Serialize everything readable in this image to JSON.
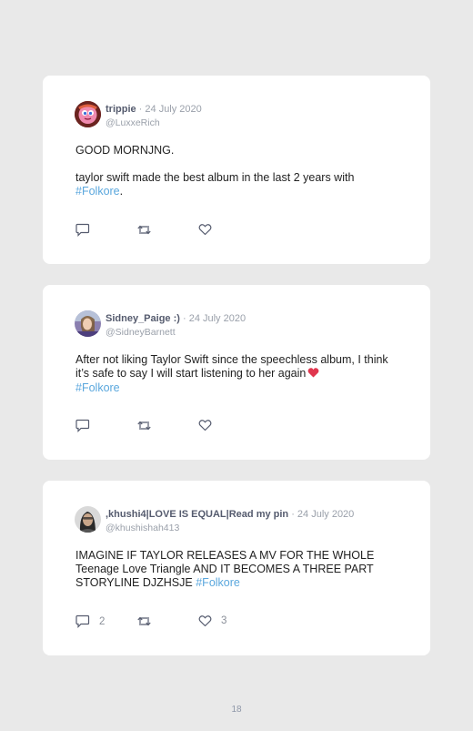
{
  "tweets": [
    {
      "name": "trippie",
      "date": " · 24 July 2020",
      "handle": "@LuxxeRich",
      "line1": "GOOD MORNJNG.",
      "line2": "taylor swift made the best album in the last 2 years with",
      "hashtag": "#Folkore",
      "after_hashtag": ".",
      "reply_count": "",
      "like_count": ""
    },
    {
      "name": "Sidney_Paige :)",
      "date": " · 24 July 2020",
      "handle": "@SidneyBarnett",
      "text": "After not liking Taylor Swift since the speechless album, I think it’s safe to say I will start listening to her again",
      "emoji": "red-heart-emoji",
      "hashtag": "#Folkore",
      "reply_count": "",
      "like_count": ""
    },
    {
      "name": ",khushi4|LOVE IS EQUAL|Read my pin",
      "date": " · 24 July 2020",
      "handle": "@khushishah413",
      "text": "IMAGINE IF TAYLOR RELEASES A MV FOR THE WHOLE Teenage Love Triangle AND IT BECOMES A THREE PART STORYLINE DJZHSJE",
      "hashtag": "#Folkore",
      "reply_count": "2",
      "like_count": "3"
    }
  ],
  "page_number": "18",
  "colors": {
    "hashtag": "#5aa7dd",
    "heart": "#e0364e",
    "background": "#e9e9e9"
  },
  "icons": [
    "reply-icon",
    "retweet-icon",
    "like-icon"
  ]
}
